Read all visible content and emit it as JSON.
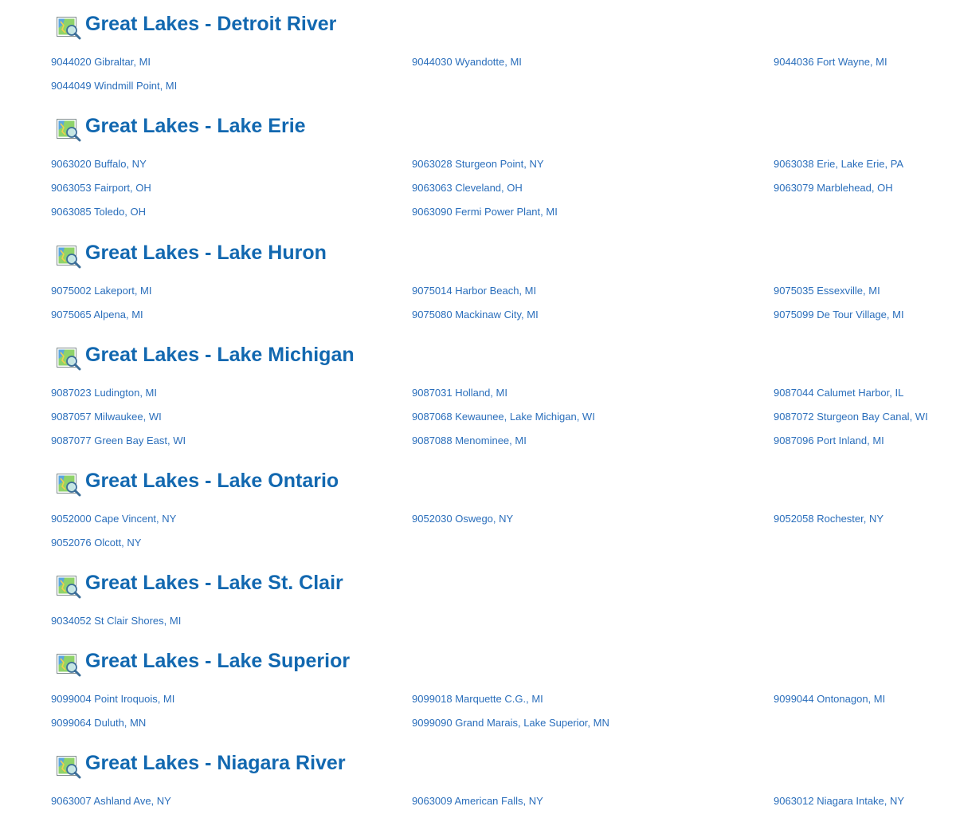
{
  "regions": [
    {
      "title": "Great Lakes - Detroit River",
      "icon": "map-search-icon",
      "stations": [
        "9044020 Gibraltar, MI",
        "9044030 Wyandotte, MI",
        "9044036 Fort Wayne, MI",
        "9044049 Windmill Point, MI"
      ]
    },
    {
      "title": "Great Lakes - Lake Erie",
      "icon": "map-search-icon",
      "stations": [
        "9063020 Buffalo, NY",
        "9063028 Sturgeon Point, NY",
        "9063038 Erie, Lake Erie, PA",
        "9063053 Fairport, OH",
        "9063063 Cleveland, OH",
        "9063079 Marblehead, OH",
        "9063085 Toledo, OH",
        "9063090 Fermi Power Plant, MI"
      ]
    },
    {
      "title": "Great Lakes - Lake Huron",
      "icon": "map-search-icon",
      "stations": [
        "9075002 Lakeport, MI",
        "9075014 Harbor Beach, MI",
        "9075035 Essexville, MI",
        "9075065 Alpena, MI",
        "9075080 Mackinaw City, MI",
        "9075099 De Tour Village, MI"
      ]
    },
    {
      "title": "Great Lakes - Lake Michigan",
      "icon": "map-search-icon",
      "stations": [
        "9087023 Ludington, MI",
        "9087031 Holland, MI",
        "9087044 Calumet Harbor, IL",
        "9087057 Milwaukee, WI",
        "9087068 Kewaunee, Lake Michigan, WI",
        "9087072 Sturgeon Bay Canal, WI",
        "9087077 Green Bay East, WI",
        "9087088 Menominee, MI",
        "9087096 Port Inland, MI"
      ]
    },
    {
      "title": "Great Lakes - Lake Ontario",
      "icon": "map-search-icon",
      "stations": [
        "9052000 Cape Vincent, NY",
        "9052030 Oswego, NY",
        "9052058 Rochester, NY",
        "9052076 Olcott, NY"
      ]
    },
    {
      "title": "Great Lakes - Lake St. Clair",
      "icon": "map-search-icon",
      "stations": [
        "9034052 St Clair Shores, MI"
      ]
    },
    {
      "title": "Great Lakes - Lake Superior",
      "icon": "map-search-icon",
      "stations": [
        "9099004 Point Iroquois, MI",
        "9099018 Marquette C.G., MI",
        "9099044 Ontonagon, MI",
        "9099064 Duluth, MN",
        "9099090 Grand Marais, Lake Superior, MN"
      ]
    },
    {
      "title": "Great Lakes - Niagara River",
      "icon": "map-search-icon",
      "stations": [
        "9063007 Ashland Ave, NY",
        "9063009 American Falls, NY",
        "9063012 Niagara Intake, NY"
      ]
    }
  ],
  "colors": {
    "link": "#2a6ebb",
    "heading": "#1268b0"
  }
}
